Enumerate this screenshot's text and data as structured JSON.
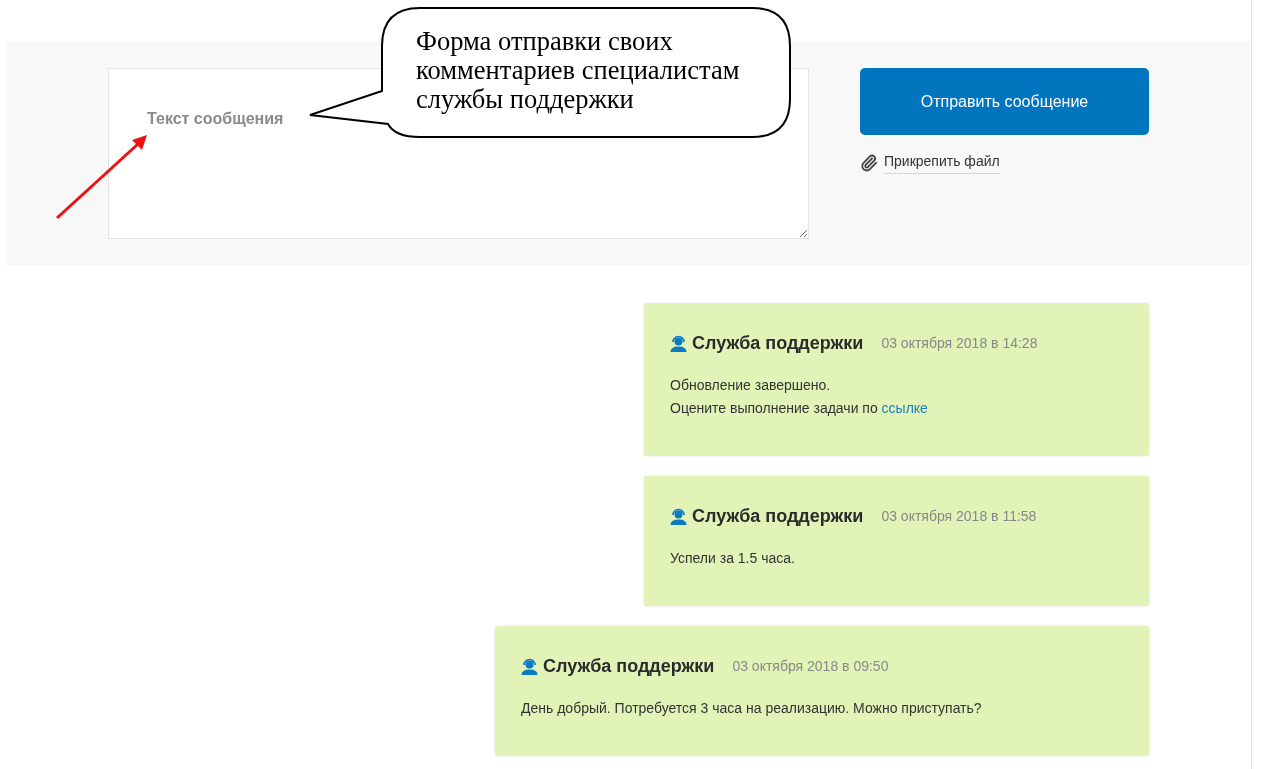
{
  "message_form": {
    "placeholder": "Текст сообщения",
    "send_button": "Отправить сообщение",
    "attach_link": "Прикрепить файл"
  },
  "annotation": {
    "text": "Форма отправки своих комментариев специалистам службы поддержки"
  },
  "messages": [
    {
      "author": "Служба поддержки",
      "date": "03 октября 2018 в 14:28",
      "lines": [
        {
          "text": "Обновление завершено."
        },
        {
          "text": "Оцените выполнение задачи по",
          "link": "ссылке"
        }
      ]
    },
    {
      "author": "Служба поддержки",
      "date": "03 октября 2018 в 11:58",
      "lines": [
        {
          "text": "Успели за 1.5 часа."
        }
      ]
    },
    {
      "author": "Служба поддержки",
      "date": "03 октября 2018 в 09:50",
      "lines": [
        {
          "text": "День добрый. Потребуется 3 часа на реализацию. Можно приступать?"
        }
      ]
    }
  ]
}
